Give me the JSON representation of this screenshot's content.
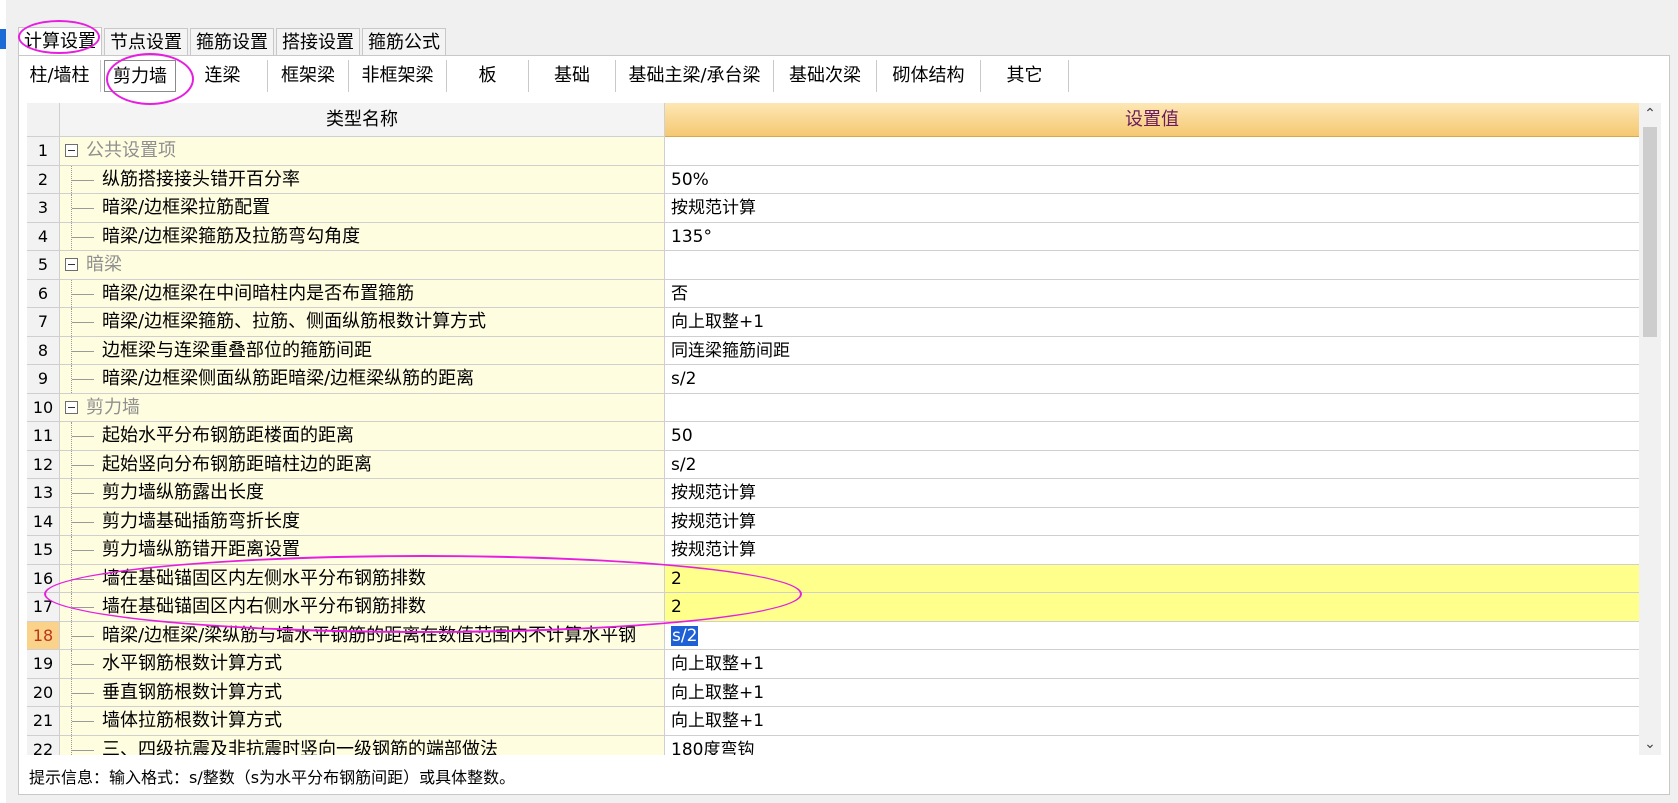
{
  "top_tabs": [
    "计算设置",
    "节点设置",
    "箍筋设置",
    "搭接设置",
    "箍筋公式"
  ],
  "sub_tabs": [
    "柱/墙柱",
    "剪力墙",
    "连梁",
    "框架梁",
    "非框架梁",
    "板",
    "基础",
    "基础主梁/承台梁",
    "基础次梁",
    "砌体结构",
    "其它"
  ],
  "grid": {
    "header_name": "类型名称",
    "header_value": "设置值",
    "rows": [
      {
        "num": "1",
        "name": "公共设置项",
        "value": "",
        "type": "group"
      },
      {
        "num": "2",
        "name": "纵筋搭接接头错开百分率",
        "value": "50%",
        "type": "item"
      },
      {
        "num": "3",
        "name": "暗梁/边框梁拉筋配置",
        "value": "按规范计算",
        "type": "item"
      },
      {
        "num": "4",
        "name": "暗梁/边框梁箍筋及拉筋弯勾角度",
        "value": "135°",
        "type": "item"
      },
      {
        "num": "5",
        "name": "暗梁",
        "value": "",
        "type": "group"
      },
      {
        "num": "6",
        "name": "暗梁/边框梁在中间暗柱内是否布置箍筋",
        "value": "否",
        "type": "item"
      },
      {
        "num": "7",
        "name": "暗梁/边框梁箍筋、拉筋、侧面纵筋根数计算方式",
        "value": "向上取整+1",
        "type": "item"
      },
      {
        "num": "8",
        "name": "边框梁与连梁重叠部位的箍筋间距",
        "value": "同连梁箍筋间距",
        "type": "item"
      },
      {
        "num": "9",
        "name": "暗梁/边框梁侧面纵筋距暗梁/边框梁纵筋的距离",
        "value": "s/2",
        "type": "item"
      },
      {
        "num": "10",
        "name": "剪力墙",
        "value": "",
        "type": "group"
      },
      {
        "num": "11",
        "name": "起始水平分布钢筋距楼面的距离",
        "value": "50",
        "type": "item"
      },
      {
        "num": "12",
        "name": "起始竖向分布钢筋距暗柱边的距离",
        "value": "s/2",
        "type": "item"
      },
      {
        "num": "13",
        "name": "剪力墙纵筋露出长度",
        "value": "按规范计算",
        "type": "item"
      },
      {
        "num": "14",
        "name": "剪力墙基础插筋弯折长度",
        "value": "按规范计算",
        "type": "item"
      },
      {
        "num": "15",
        "name": "剪力墙纵筋错开距离设置",
        "value": "按规范计算",
        "type": "item"
      },
      {
        "num": "16",
        "name": "墙在基础锚固区内左侧水平分布钢筋排数",
        "value": "2",
        "type": "item",
        "highlight": true
      },
      {
        "num": "17",
        "name": "墙在基础锚固区内右侧水平分布钢筋排数",
        "value": "2",
        "type": "item",
        "highlight": true
      },
      {
        "num": "18",
        "name": "暗梁/边框梁/梁纵筋与墙水平钢筋的距离在数值范围内不计算水平钢",
        "value": "s/2",
        "type": "item",
        "current": true
      },
      {
        "num": "19",
        "name": "水平钢筋根数计算方式",
        "value": "向上取整+1",
        "type": "item"
      },
      {
        "num": "20",
        "name": "垂直钢筋根数计算方式",
        "value": "向上取整+1",
        "type": "item"
      },
      {
        "num": "21",
        "name": "墙体拉筋根数计算方式",
        "value": "向上取整+1",
        "type": "item"
      },
      {
        "num": "22",
        "name": "三、四级抗震及非抗震时竖向一级钢筋的端部做法",
        "value": "180度弯钩",
        "type": "item"
      }
    ]
  },
  "hint": "提示信息：输入格式：s/整数（s为水平分布钢筋间距）或具体整数。",
  "icons": {
    "scroll_up": "chevron-up-icon",
    "scroll_down": "chevron-down-icon",
    "expander": "minus-box-icon"
  },
  "colors": {
    "header_value_bg": "#f5c872",
    "highlight_row": "#ffff8c",
    "annotation": "#e71ee0",
    "selection": "#1f5fd6"
  }
}
